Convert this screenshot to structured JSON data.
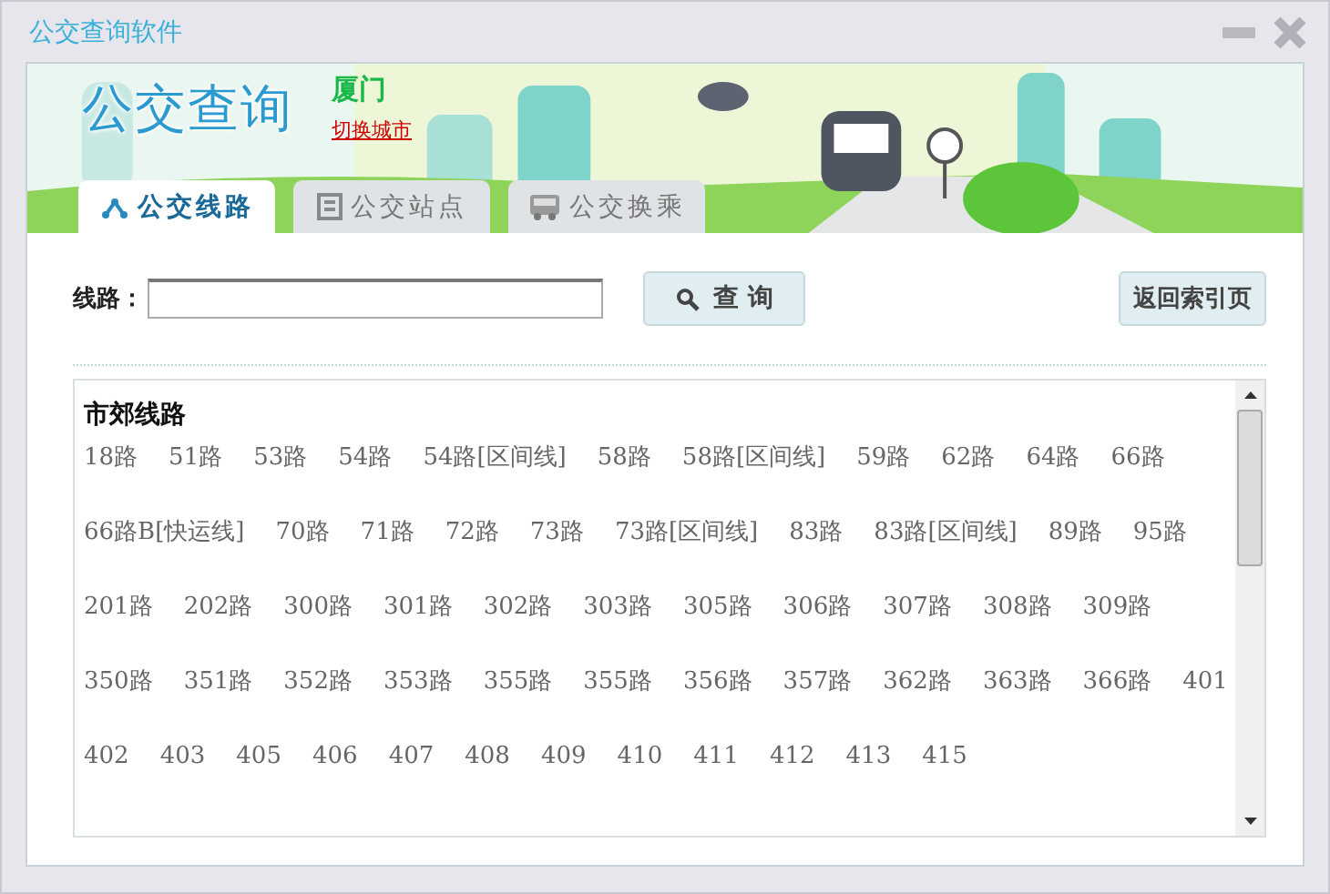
{
  "window": {
    "title": "公交查询软件"
  },
  "banner": {
    "title": "公交查询",
    "city": "厦门",
    "switch_link": "切换城市"
  },
  "tabs": [
    {
      "label": "公交线路",
      "kind": "route",
      "selected": true
    },
    {
      "label": "公交站点",
      "kind": "stop",
      "selected": false
    },
    {
      "label": "公交换乘",
      "kind": "bus",
      "selected": false
    }
  ],
  "search": {
    "label": "线路：",
    "button": "查 询",
    "index_button": "返回索引页"
  },
  "routes": {
    "heading": "市郊线路",
    "items": [
      "18路",
      "51路",
      "53路",
      "54路",
      "54路[区间线]",
      "58路",
      "58路[区间线]",
      "59路",
      "62路",
      "64路",
      "66路",
      "66路B[快运线]",
      "70路",
      "71路",
      "72路",
      "73路",
      "73路[区间线]",
      "83路",
      "83路[区间线]",
      "89路",
      "95路",
      "201路",
      "202路",
      "300路",
      "301路",
      "302路",
      "303路",
      "305路",
      "306路",
      "307路",
      "308路",
      "309路",
      "350路",
      "351路",
      "352路",
      "353路",
      "355路",
      "355路",
      "356路",
      "357路",
      "362路",
      "363路",
      "366路",
      "401",
      "402",
      "403",
      "405",
      "406",
      "407",
      "408",
      "409",
      "410",
      "411",
      "412",
      "413",
      "415"
    ]
  }
}
